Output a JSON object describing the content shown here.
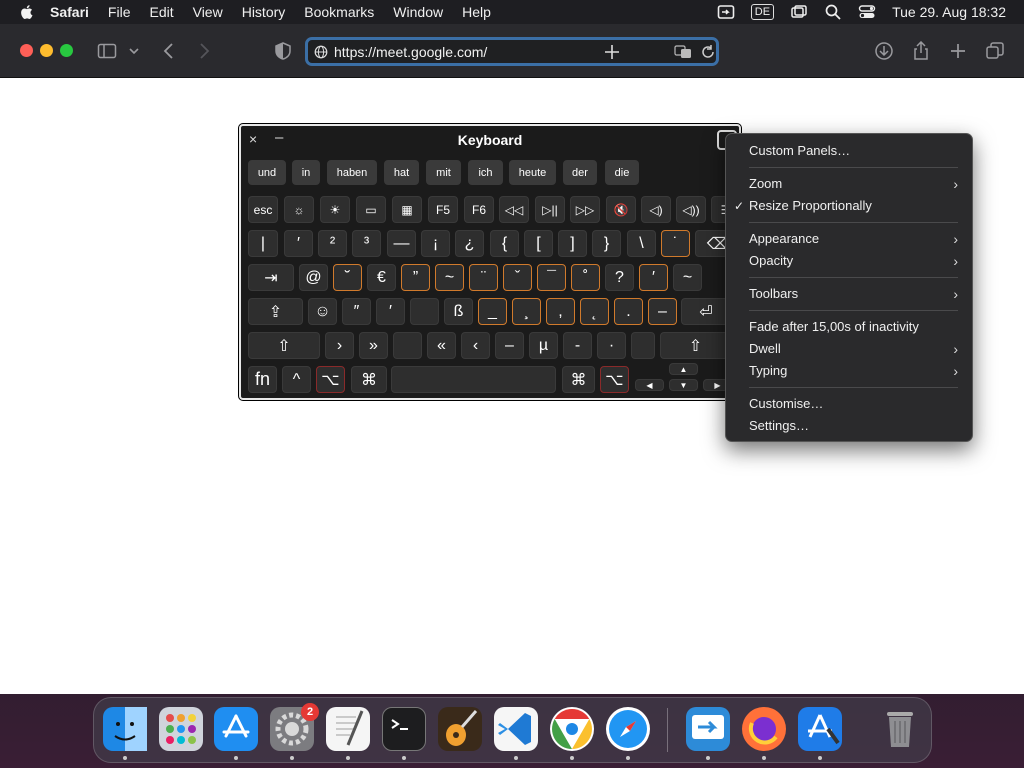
{
  "menubar": {
    "app_name": "Safari",
    "menus": [
      "File",
      "Edit",
      "View",
      "History",
      "Bookmarks",
      "Window",
      "Help"
    ],
    "input_source": "DE",
    "clock": "Tue 29. Aug  18:32"
  },
  "safari": {
    "url": "https://meet.google.com/"
  },
  "keyboard": {
    "title": "Keyboard",
    "close_glyph": "×",
    "min_glyph": "–",
    "suggestions": [
      "und",
      "in",
      "haben",
      "hat",
      "mit",
      "ich",
      "heute",
      "der",
      "die"
    ],
    "row_fn": [
      "esc",
      "☼",
      "☀",
      "▭",
      "▦",
      "F5",
      "F6",
      "◁◁",
      "▷||",
      "▷▷",
      "🔇",
      "◁)",
      "◁))",
      "☰"
    ],
    "row_1": [
      "|",
      "′",
      "²",
      "³",
      "—",
      "¡",
      "¿",
      "{",
      "[",
      "]",
      "}",
      "\\",
      "˙",
      "⌫"
    ],
    "row_2": [
      "⇥",
      "@",
      "˘",
      "€",
      "”",
      "~",
      "¨",
      "ˇ",
      "¯",
      "˚",
      "?",
      "′",
      "~"
    ],
    "row_3": [
      "⇪",
      "☺",
      "″",
      "′",
      "",
      "ß",
      "_",
      "¸",
      ",",
      "˛",
      ".",
      "–",
      "⏎"
    ],
    "row_4": [
      "⇧",
      "›",
      "»",
      "",
      "«",
      "‹",
      "–",
      "µ",
      "-",
      "·",
      "",
      "⇧"
    ],
    "row_5": [
      "fn",
      "^",
      "⌥",
      "⌘",
      "",
      "⌘",
      "⌥"
    ],
    "arrows": [
      "▲",
      "◀",
      "▼",
      "▶"
    ]
  },
  "context_menu": {
    "items": [
      {
        "label": "Custom Panels…",
        "check": "",
        "chev": ""
      },
      {
        "label": "Zoom",
        "check": "",
        "chev": "›"
      },
      {
        "label": "Resize Proportionally",
        "check": "✓",
        "chev": ""
      },
      {
        "label": "Appearance",
        "check": "",
        "chev": "›"
      },
      {
        "label": "Opacity",
        "check": "",
        "chev": "›"
      },
      {
        "label": "Toolbars",
        "check": "",
        "chev": "›"
      },
      {
        "label": "Fade after 15,00s of inactivity",
        "check": "",
        "chev": ""
      },
      {
        "label": "Dwell",
        "check": "",
        "chev": "›"
      },
      {
        "label": "Typing",
        "check": "",
        "chev": "›"
      },
      {
        "label": "Customise…",
        "check": "",
        "chev": ""
      },
      {
        "label": "Settings…",
        "check": "",
        "chev": ""
      }
    ]
  },
  "dock": {
    "settings_badge": "2",
    "icons": [
      "finder-icon",
      "launchpad-icon",
      "app-store-icon",
      "system-settings-icon",
      "textedit-icon",
      "terminal-icon",
      "garageband-icon",
      "vscode-icon",
      "chrome-icon",
      "safari-icon",
      "screen-sharing-icon",
      "firefox-icon",
      "xcode-icon",
      "trash-icon"
    ],
    "colors": {
      "finder": "#1e88e5",
      "launchpad": "#d0d4dc",
      "appstore": "#1f8ef1",
      "settings": "#7c7c80",
      "textedit": "#f5f5f5",
      "terminal": "#1d1d1f",
      "garageband": "#f0a030",
      "vscode": "#f6f6f6",
      "chrome": "#ffffff",
      "safari": "#ffffff",
      "screenshare": "#2d8bd8",
      "firefox": "#ff7139",
      "xcode": "#1f7ce8",
      "trash": "#8e8e92"
    }
  }
}
